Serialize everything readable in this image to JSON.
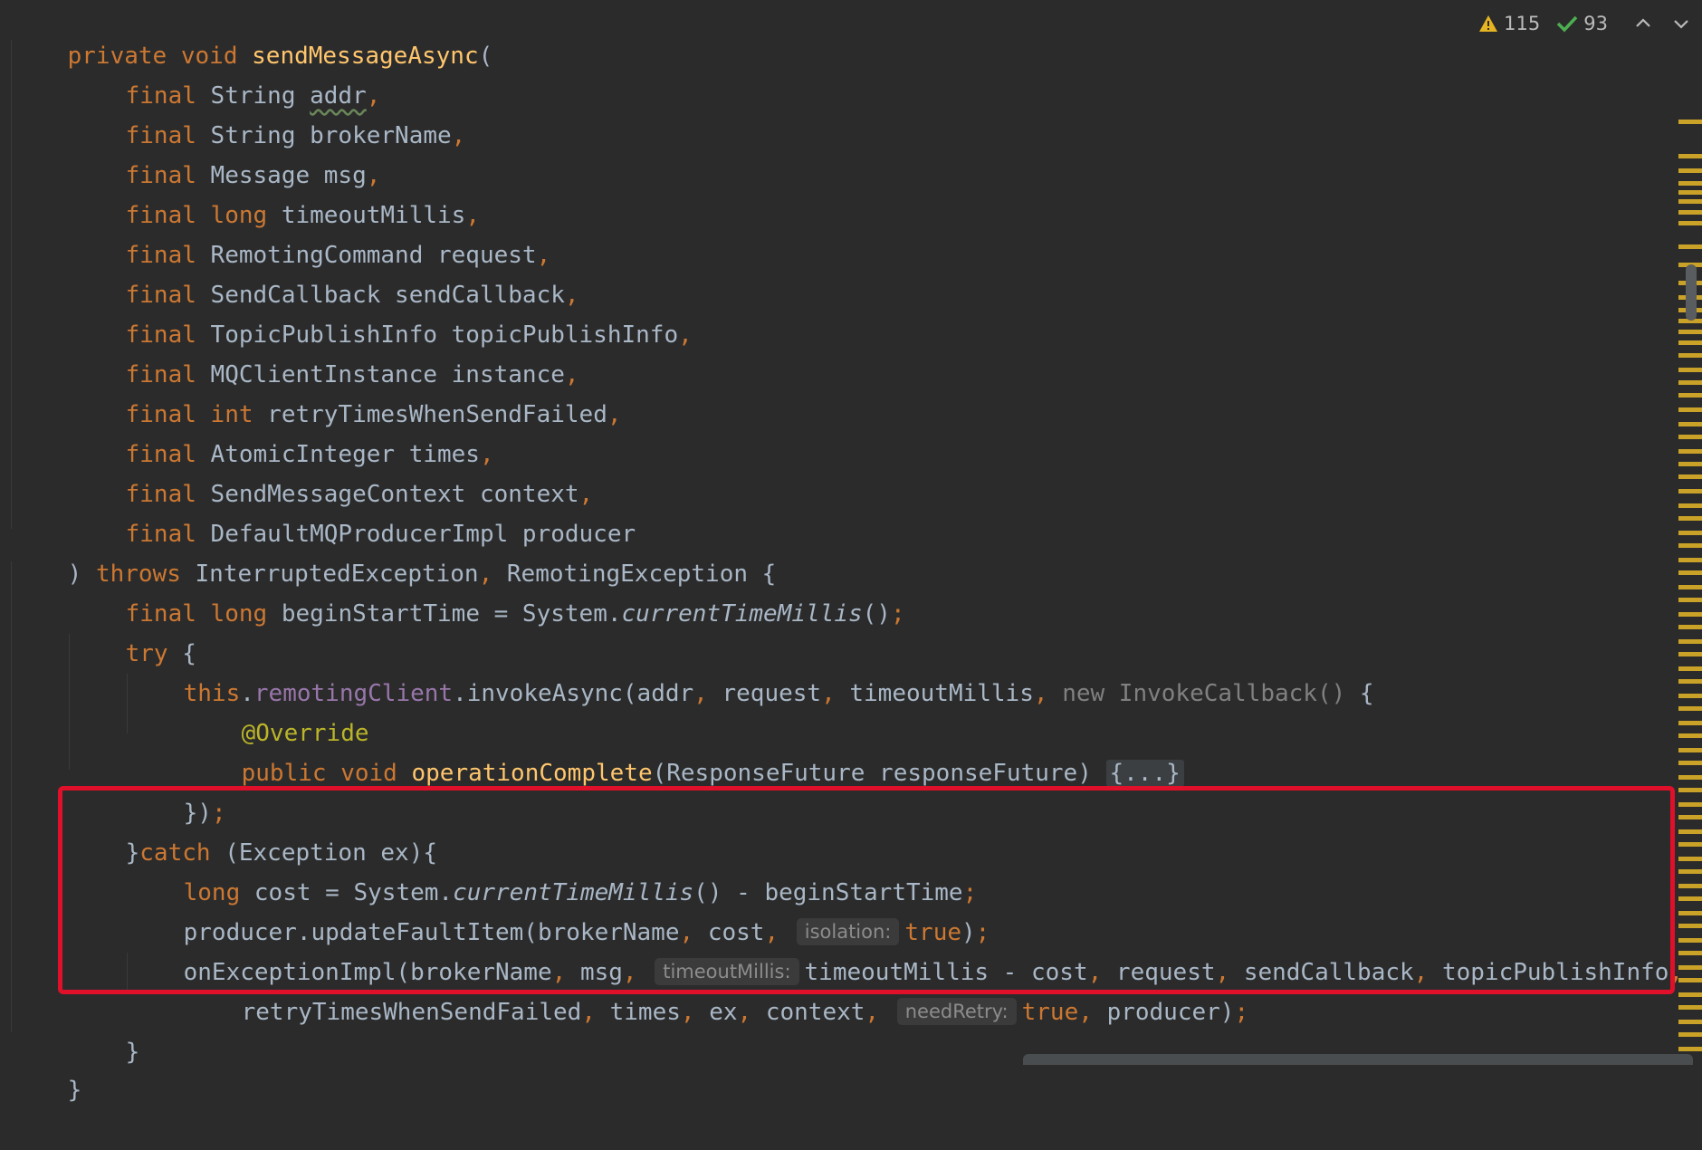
{
  "inspection": {
    "warnings": "115",
    "weak_warnings": "93",
    "colors": {
      "warning": "#e6b422",
      "ok": "#4caf50"
    }
  },
  "code": {
    "l01": [
      "private ",
      "void ",
      "sendMessageAsync",
      "("
    ],
    "l02": [
      "final ",
      "String ",
      "addr",
      ","
    ],
    "l03": [
      "final ",
      "String brokerName",
      ","
    ],
    "l04": [
      "final ",
      "Message msg",
      ","
    ],
    "l05": [
      "final ",
      "long ",
      "timeoutMillis",
      ","
    ],
    "l06": [
      "final ",
      "RemotingCommand request",
      ","
    ],
    "l07": [
      "final ",
      "SendCallback sendCallback",
      ","
    ],
    "l08": [
      "final ",
      "TopicPublishInfo topicPublishInfo",
      ","
    ],
    "l09": [
      "final ",
      "MQClientInstance instance",
      ","
    ],
    "l10": [
      "final ",
      "int ",
      "retryTimesWhenSendFailed",
      ","
    ],
    "l11": [
      "final ",
      "AtomicInteger times",
      ","
    ],
    "l12": [
      "final ",
      "SendMessageContext context",
      ","
    ],
    "l13": [
      "final ",
      "DefaultMQProducerImpl producer"
    ],
    "l14": [
      ") ",
      "throws ",
      "InterruptedException",
      ", ",
      "RemotingException {"
    ],
    "l15": [
      "final ",
      "long ",
      "beginStartTime = System.",
      "currentTimeMillis",
      "()",
      ";"
    ],
    "l16": [
      "try ",
      "{"
    ],
    "l17": [
      "this",
      ".",
      "remotingClient",
      ".invokeAsync(addr",
      ", ",
      "request",
      ", ",
      "timeoutMillis",
      ", ",
      "new InvokeCallback() ",
      "{"
    ],
    "l18": [
      "@Override"
    ],
    "l19": [
      "public ",
      "void ",
      "operationComplete",
      "(ResponseFuture responseFuture) ",
      "{...}"
    ],
    "l20": [
      "})",
      ";"
    ],
    "l21": [
      "}",
      "catch ",
      "(Exception ex){"
    ],
    "l22": [
      "long ",
      "cost = System.",
      "currentTimeMillis",
      "() - beginStartTime",
      ";"
    ],
    "l23": [
      "producer.updateFaultItem(brokerName",
      ", ",
      "cost",
      ", ",
      "isolation:",
      "true",
      ")",
      ";"
    ],
    "l24": [
      "onExceptionImpl(brokerName",
      ", ",
      "msg",
      ", ",
      "timeoutMillis:",
      "timeoutMillis - cost",
      ", ",
      "request",
      ", ",
      "sendCallback",
      ", ",
      "topicPublishInfo",
      ","
    ],
    "l25": [
      "retryTimesWhenSendFailed",
      ", ",
      "times",
      ", ",
      "ex",
      ", ",
      "context",
      ", ",
      "needRetry:",
      "true",
      ", ",
      "producer)",
      ";"
    ],
    "l26": [
      "}"
    ],
    "l27": [
      "}"
    ]
  }
}
